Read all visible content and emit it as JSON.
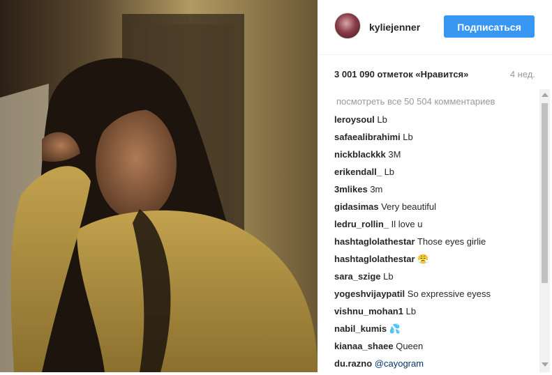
{
  "post": {
    "username": "kyliejenner",
    "follow_label": "Подписаться",
    "likes_text": "3 001 090 отметок «Нравится»",
    "time_ago": "4 нед.",
    "view_all_comments": "посмотреть все 50 504 комментариев"
  },
  "comments": [
    {
      "user": "leroysoul",
      "text": "Lb"
    },
    {
      "user": "safaealibrahimi",
      "text": "Lb"
    },
    {
      "user": "nickblackkk",
      "text": "3M"
    },
    {
      "user": "erikendall_",
      "text": "Lb"
    },
    {
      "user": "3mlikes",
      "text": "3m"
    },
    {
      "user": "gidasimas",
      "text": "Very beautiful"
    },
    {
      "user": "ledru_rollin_",
      "text": "Il love u"
    },
    {
      "user": "hashtaglolathestar",
      "text": "Those eyes girlie"
    },
    {
      "user": "hashtaglolathestar",
      "text": "😤"
    },
    {
      "user": "sara_szige",
      "text": "Lb"
    },
    {
      "user": "yogeshvijaypatil",
      "text": "So expressive eyess"
    },
    {
      "user": "vishnu_mohan1",
      "text": "Lb"
    },
    {
      "user": "nabil_kumis",
      "text": "💦"
    },
    {
      "user": "kianaa_shaee",
      "text": "Queen"
    },
    {
      "user": "du.razno",
      "text": "",
      "mention": "@cayogram"
    }
  ],
  "colors": {
    "accent": "#3897f0",
    "text": "#262626",
    "muted": "#999999"
  }
}
